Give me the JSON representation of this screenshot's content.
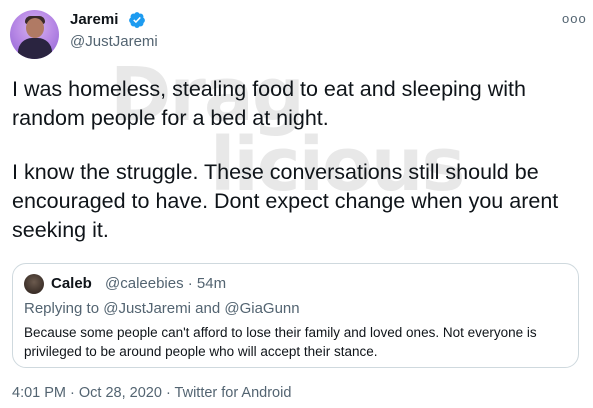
{
  "author": {
    "name": "Jaremi",
    "handle": "@JustJaremi",
    "avatar_icon": "profile-photo",
    "verified_icon": "verified-badge-icon",
    "verified_color": "#1d9bf0"
  },
  "more_icon": "more-options-icon",
  "more_label": "ooo",
  "tweet": {
    "paragraphs": [
      "I was homeless, stealing food to eat and sleeping with random people for a bed at night.",
      "I know the struggle. These conversations still should be encouraged to have. Dont expect change when you arent seeking it."
    ]
  },
  "watermark": {
    "line1": "Drag",
    "line2": "licious"
  },
  "quoted_tweet": {
    "name": "Caleb",
    "handle": "@caleebies · 54m",
    "reply_prefix": "Replying to",
    "reply_user1": "@JustJaremi",
    "reply_and": "and",
    "reply_user2": "@GiaGunn",
    "text": "Because some people can't afford to lose their family and loved ones. Not everyone is privileged to be around people who will accept their stance."
  },
  "meta": {
    "timestamp": "4:01 PM · Oct 28, 2020 · Twitter for Android"
  },
  "colors": {
    "text": "#0f1419",
    "secondary": "#536471",
    "border": "#cfd9de",
    "accent": "#1d9bf0"
  }
}
